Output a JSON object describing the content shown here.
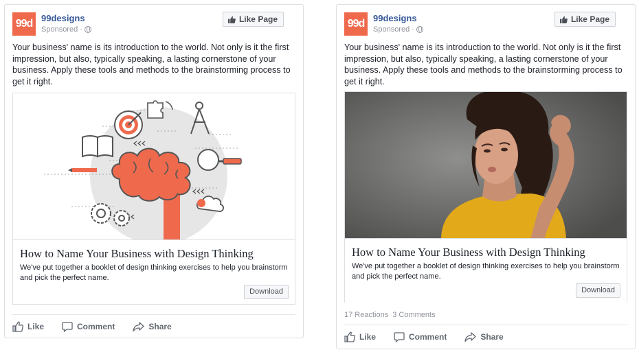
{
  "colors": {
    "brand": "#ef6a4d",
    "link": "#365899",
    "meta": "#90949c"
  },
  "posts": [
    {
      "page_name": "99designs",
      "avatar_text": "99d",
      "sponsored": "Sponsored",
      "meta_sep": "·",
      "like_page": "Like Page",
      "text": "Your business' name is its introduction to the world. Not only is it the first impression, but also, typically speaking, a lasting cornerstone of your business. Apply these tools and methods to the brainstorming process to get it right.",
      "card": {
        "image": "brain-illustration",
        "title": "How to Name Your Business with Design Thinking",
        "description": "We've put together a booklet of design thinking exercises to help you brainstorm and pick the perfect name.",
        "button": "Download"
      },
      "actions": {
        "like": "Like",
        "comment": "Comment",
        "share": "Share"
      }
    },
    {
      "page_name": "99designs",
      "avatar_text": "99d",
      "sponsored": "Sponsored",
      "meta_sep": "·",
      "like_page": "Like Page",
      "text": "Your business' name is its introduction to the world. Not only is it the first impression, but also, typically speaking, a lasting cornerstone of your business. Apply these tools and methods to the brainstorming process to get it right.",
      "card": {
        "image": "thinking-woman-photo",
        "title": "How to Name Your Business with Design Thinking",
        "description": "We've put together a booklet of design thinking exercises to help you brainstorm and pick the perfect name.",
        "button": "Download"
      },
      "reactions": "17 Reactions",
      "comments_count": "3 Comments",
      "actions": {
        "like": "Like",
        "comment": "Comment",
        "share": "Share"
      }
    }
  ]
}
